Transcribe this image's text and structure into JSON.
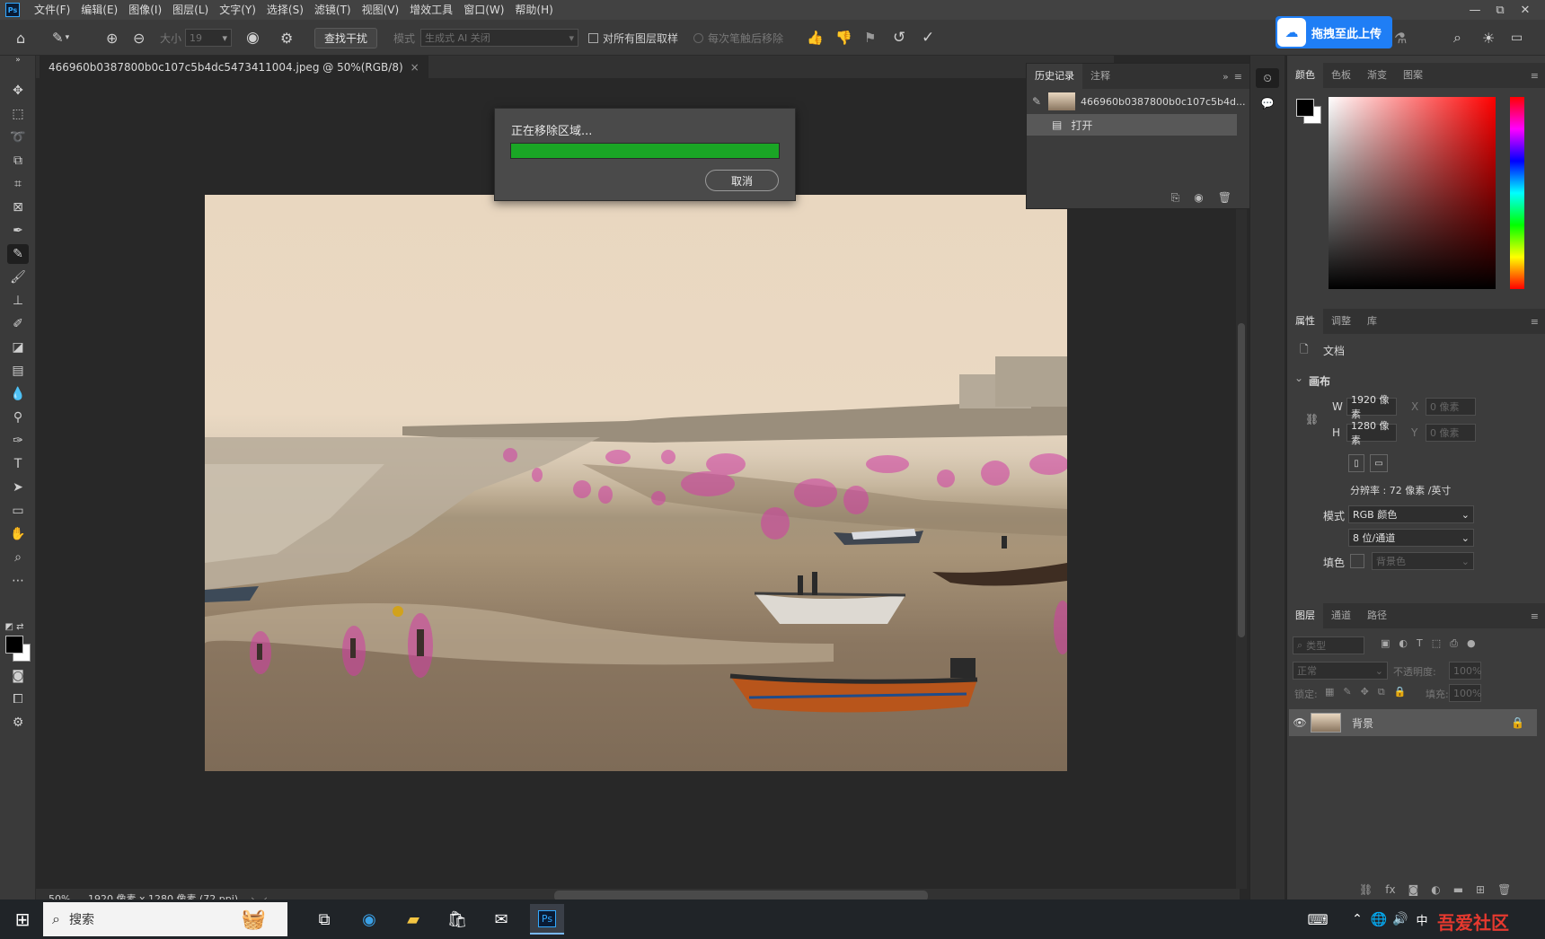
{
  "menubar": {
    "logo": "Ps",
    "items": [
      "文件(F)",
      "编辑(E)",
      "图像(I)",
      "图层(L)",
      "文字(Y)",
      "选择(S)",
      "滤镜(T)",
      "视图(V)",
      "增效工具",
      "窗口(W)",
      "帮助(H)"
    ],
    "controls": [
      "—",
      "⧉",
      "✕"
    ]
  },
  "options": {
    "size_label": "大小",
    "size_value": "19",
    "find_distraction": "查找干扰",
    "mode_label": "模式",
    "mode_value": "生成式 AI 关闭",
    "sample_all_layers": "对所有图层取样",
    "remove_after_stroke": "每次笔触后移除",
    "upload_label": "拖拽至此上传"
  },
  "document": {
    "tab_title": "466960b0387800b0c107c5b4dc5473411004.jpeg @ 50%(RGB/8)",
    "zoom": "50%",
    "info": "1920 像素 x 1280 像素 (72 ppi)"
  },
  "dialog": {
    "title": "正在移除区域...",
    "progress": 1.0,
    "cancel": "取消"
  },
  "history": {
    "tabs": [
      "历史记录",
      "注释"
    ],
    "snapshot_name": "466960b0387800b0c107c5b4d...",
    "step": "打开"
  },
  "color_panel": {
    "tabs": [
      "颜色",
      "色板",
      "渐变",
      "图案"
    ]
  },
  "properties": {
    "tabs": [
      "属性",
      "调整",
      "库"
    ],
    "doc_label": "文档",
    "canvas_label": "画布",
    "w_label": "W",
    "w_value": "1920 像素",
    "h_label": "H",
    "h_value": "1280 像素",
    "x_label": "X",
    "x_value": "0 像素",
    "y_label": "Y",
    "y_value": "0 像素",
    "resolution": "分辨率 : 72 像素 /英寸",
    "mode_label": "模式",
    "mode_value": "RGB 颜色",
    "depth_value": "8 位/通道",
    "fill_label": "填色",
    "fill_value": "背景色"
  },
  "layers": {
    "tabs": [
      "图层",
      "通道",
      "路径"
    ],
    "filter_placeholder": "类型",
    "blend_mode": "正常",
    "opacity_label": "不透明度:",
    "opacity_value": "100%",
    "lock_label": "锁定:",
    "fill_label": "填充:",
    "fill_value": "100%",
    "layer_name": "背景"
  },
  "taskbar": {
    "search_placeholder": "搜索",
    "ime": "中",
    "watermark": "吾爱社区"
  },
  "colors": {
    "accent": "#1f7ef5",
    "progress": "#1aa625",
    "mask": "#d23ca5"
  }
}
